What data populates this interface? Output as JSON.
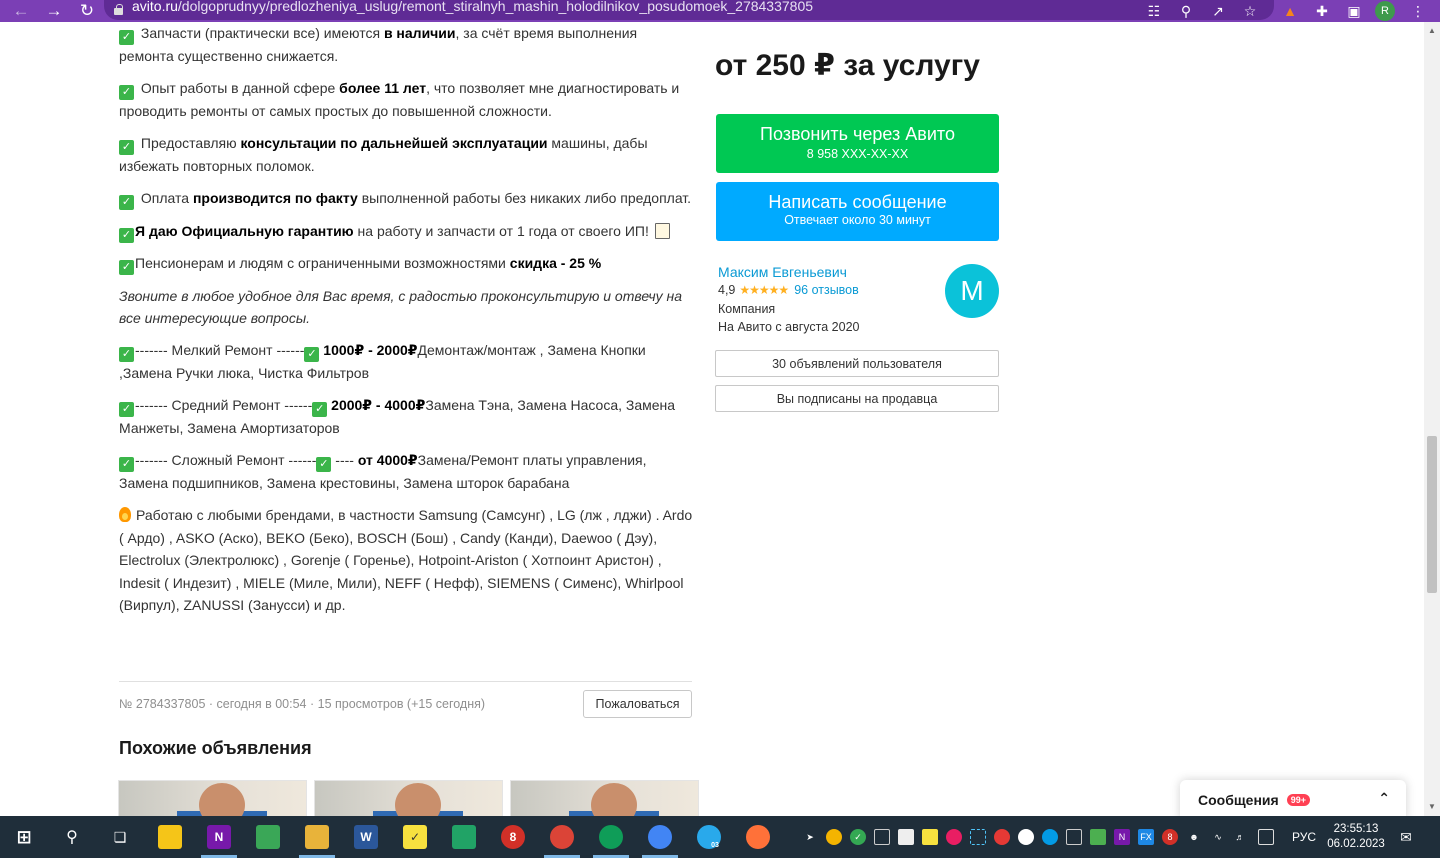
{
  "browser": {
    "url_host": "avito.ru",
    "url_path": "/dolgoprudnyy/predlozheniya_uslug/remont_stiralnyh_mashin_holodilnikov_posudomoek_2784337805",
    "profile_initial": "R",
    "accent_color": "#7b3fb5"
  },
  "description": {
    "p1": {
      "pre": " Запчасти (практически все) имеются ",
      "bold": "в наличии",
      "post": ", за счёт время выполнения ремонта существенно снижается."
    },
    "p2": {
      "pre": " Опыт работы в данной сфере ",
      "bold": "более 11 лет",
      "post": ", что позволяет мне диагностировать и проводить ремонты от самых простых до повышенной сложности."
    },
    "p3": {
      "pre": " Предоставляю ",
      "bold": "консультации по дальнейшей эксплуатации",
      "post": " машины, дабы избежать повторных поломок."
    },
    "p4": {
      "pre": " Оплата ",
      "bold": "производится по факту",
      "post": " выполненной работы без никаких либо предоплат."
    },
    "p5": {
      "bold": "Я даю Официальную гарантию",
      "post": " на работу и запчасти от 1 года от своего ИП!"
    },
    "p6": {
      "pre": "Пенсионерам и людям с ограниченными возможностями ",
      "bold": "скидка - 25 %"
    },
    "p7": "Звоните в любое удобное для Вас время, с радостью проконсультирую и отвечу на все интересующие вопросы.",
    "p8": {
      "pre": "------- Мелкий Ремонт ------",
      "bold": " 1000₽ - 2000₽",
      "post": "Демонтаж/монтаж , Замена Кнопки ,Замена Ручки люка, Чистка Фильтров"
    },
    "p9": {
      "pre": "------- Средний Ремонт ------",
      "bold": " 2000₽ - 4000₽",
      "post": "Замена Тэна, Замена Насоса, Замена Манжеты, Замена Амортизаторов"
    },
    "p10": {
      "pre": "------- Сложный Ремонт ------",
      "mid": " ---- ",
      "bold": "от 4000₽",
      "post": "Замена/Ремонт платы управления, Замена подшипников, Замена крестовины, Замена шторок барабана"
    },
    "p11": "Работаю с любыми брендами, в частности Samsung (Самсунг) , LG (лж , лджи) . Ardo ( Ардо) , ASKO (Аско), BEKO (Беко), BOSCH (Бош) , Candy (Канди), Daewoo ( Дэу), Electrolux (Электролюкс) , Gorenje ( Горенье), Hotpoint-Ariston ( Хотпоинт Аристон) , Indesit ( Индезит) , MIELE (Миле, Мили), NEFF ( Нефф), SIEMENS ( Сименс), Whirlpool (Вирпул), ZANUSSI (Занусси) и др."
  },
  "meta": {
    "line": "№ 2784337805 · сегодня в 00:54 · 15 просмотров (+15 сегодня)",
    "complain_label": "Пожаловаться"
  },
  "similar": {
    "title": "Похожие объявления"
  },
  "sidebar": {
    "price": "от 250 ₽ за услугу",
    "call_label": "Позвонить через Авито",
    "call_phone": "8 958 XXX-XX-XX",
    "message_label": "Написать сообщение",
    "message_sub": "Отвечает около 30 минут",
    "seller": {
      "name": "Максим Евгеньевич",
      "rating": "4,9",
      "stars": "★★★★★",
      "reviews": "96 отзывов",
      "type": "Компания",
      "since": "На Авито с августа 2020",
      "avatar_letter": "M"
    },
    "listings_button": "30 объявлений пользователя",
    "subscribed_button": "Вы подписаны на продавца"
  },
  "messages_widget": {
    "label": "Сообщения",
    "badge": "99+"
  },
  "taskbar": {
    "language": "РУС",
    "time": "23:55:13",
    "date": "06.02.2023",
    "telegram_badge": "03"
  },
  "colors": {
    "call_green": "#00c853",
    "message_blue": "#00aaff",
    "link_blue": "#0a9ad4",
    "checkmark_green": "#3bb54a"
  }
}
